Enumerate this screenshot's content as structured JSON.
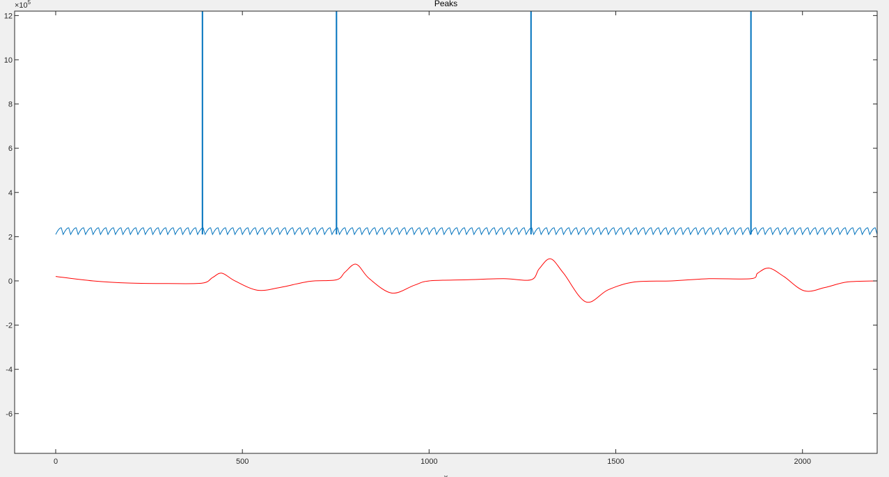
{
  "chart_data": {
    "type": "line",
    "title": "Peaks",
    "xlabel": "x",
    "ylabel": "",
    "xlim": [
      -110,
      2200
    ],
    "ylim": [
      -7.8,
      12.2
    ],
    "y_exponent_label": "×10",
    "y_exponent_power": "5",
    "x_ticks": [
      0,
      500,
      1000,
      1500,
      2000
    ],
    "x_tick_labels": [
      "0",
      "500",
      "1000",
      "1500",
      "2000"
    ],
    "y_ticks": [
      -6,
      -4,
      -2,
      0,
      2,
      4,
      6,
      8,
      10,
      12
    ],
    "y_tick_labels": [
      "-6",
      "-4",
      "-2",
      "0",
      "2",
      "4",
      "6",
      "8",
      "10",
      "12"
    ],
    "grid": false,
    "legend": "none",
    "colors": {
      "blue": "#0072bd",
      "red": "#ff0000",
      "axis": "#262626",
      "plot_bg": "#ffffff",
      "figure_bg": "#f0f0f0"
    },
    "series": [
      {
        "color": "#0072bd",
        "description_values": {
          "baseline_range": [
            2.1,
            2.4
          ],
          "x_range": [
            0,
            2200
          ],
          "oscillation_period": 20,
          "spikes": [
            {
              "x": 393,
              "y": 12.2
            },
            {
              "x": 752,
              "y": 12.2
            },
            {
              "x": 1273,
              "y": 12.2
            },
            {
              "x": 1862,
              "y": 12.2
            }
          ]
        }
      },
      {
        "color": "#ff0000",
        "x": [
          0,
          100,
          200,
          300,
          393,
          420,
          445,
          480,
          540,
          600,
          680,
          752,
          775,
          805,
          840,
          900,
          960,
          1000,
          1100,
          1200,
          1273,
          1295,
          1325,
          1360,
          1420,
          1480,
          1550,
          1650,
          1750,
          1862,
          1880,
          1910,
          1950,
          2005,
          2060,
          2120,
          2200
        ],
        "y": [
          0.2,
          0.0,
          -0.1,
          -0.12,
          -0.1,
          0.15,
          0.35,
          0.0,
          -0.42,
          -0.3,
          -0.02,
          0.05,
          0.4,
          0.75,
          0.1,
          -0.55,
          -0.2,
          0.0,
          0.05,
          0.1,
          0.05,
          0.55,
          1.0,
          0.35,
          -0.95,
          -0.4,
          -0.05,
          0.0,
          0.1,
          0.1,
          0.35,
          0.58,
          0.2,
          -0.45,
          -0.3,
          -0.05,
          0.0
        ]
      }
    ]
  }
}
